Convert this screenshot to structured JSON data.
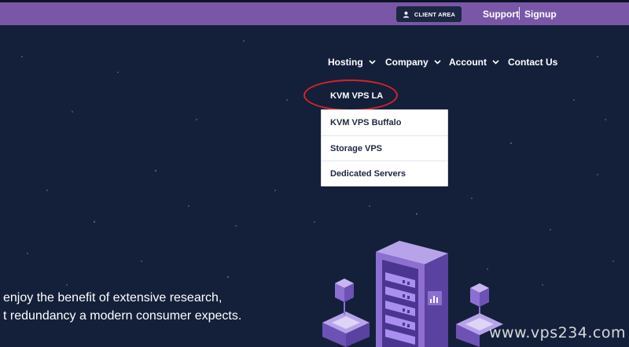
{
  "topbar": {
    "client_area_label": "CLIENT AREA",
    "support_label": "Support",
    "signup_label": "Signup"
  },
  "nav": {
    "items": [
      {
        "label": "Hosting",
        "has_dropdown": true
      },
      {
        "label": "Company",
        "has_dropdown": true
      },
      {
        "label": "Account",
        "has_dropdown": true
      },
      {
        "label": "Contact Us",
        "has_dropdown": false
      }
    ]
  },
  "hosting_menu": {
    "highlighted_item": "KVM VPS LA",
    "items": [
      "KVM VPS Buffalo",
      "Storage VPS",
      "Dedicated Servers"
    ]
  },
  "hero": {
    "line1": " enjoy the benefit of extensive research,",
    "line2": "t redundancy a modern consumer expects."
  },
  "watermark": "www.vps234.com",
  "colors": {
    "topbar": "#7a57a6",
    "background": "#14203a",
    "annotation_circle": "#d8232a",
    "server_purple": "#8d6fd1"
  }
}
